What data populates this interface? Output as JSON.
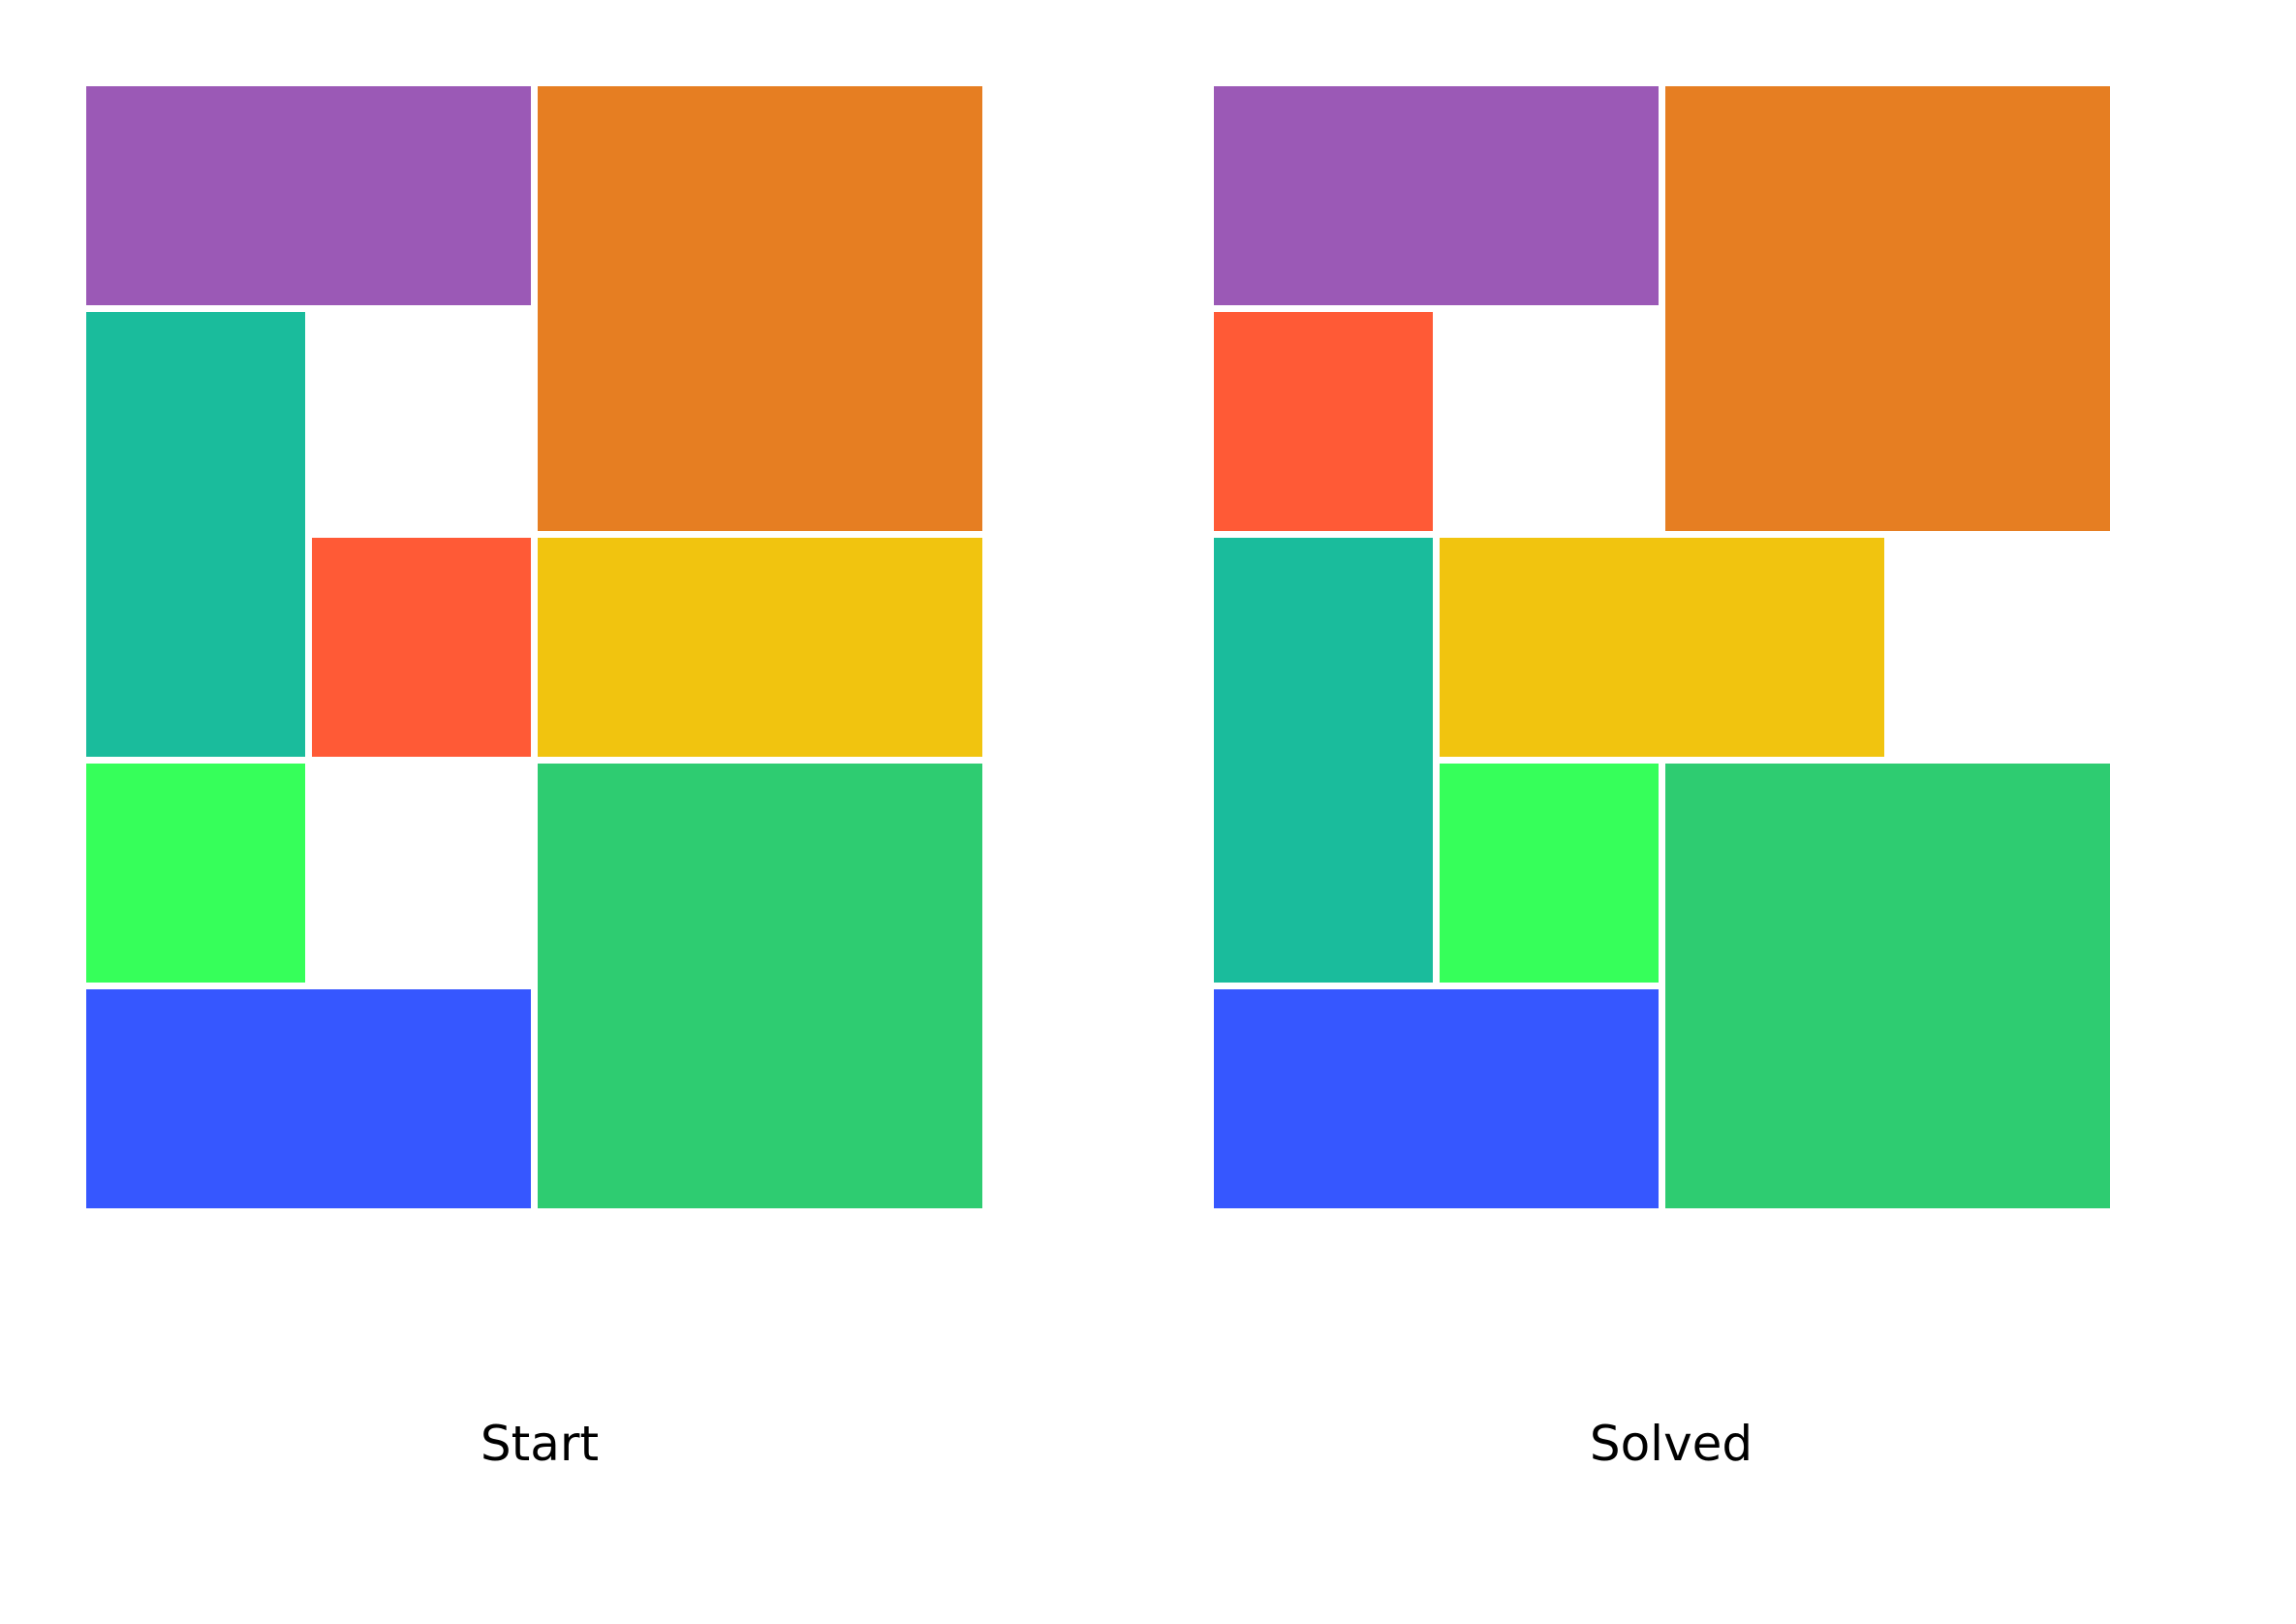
{
  "puzzle": {
    "grid": {
      "cols": 4,
      "rows": 5
    },
    "colors": {
      "purple": "#9b59b6",
      "orange": "#e67e22",
      "teal": "#1abc9c",
      "red": "#ff5a36",
      "yellow": "#f1c40f",
      "green": "#2ecc71",
      "lime": "#36ff5a",
      "blue": "#3657ff"
    },
    "boards": [
      {
        "id": "start",
        "caption": "Start",
        "pieces": [
          {
            "name": "purple-block",
            "color": "#9b59b6",
            "col": 0,
            "row": 0,
            "w": 2,
            "h": 1
          },
          {
            "name": "orange-block",
            "color": "#e67e22",
            "col": 2,
            "row": 0,
            "w": 2,
            "h": 2
          },
          {
            "name": "teal-block",
            "color": "#1abc9c",
            "col": 0,
            "row": 1,
            "w": 1,
            "h": 2
          },
          {
            "name": "red-block",
            "color": "#ff5a36",
            "col": 1,
            "row": 2,
            "w": 1,
            "h": 1
          },
          {
            "name": "yellow-block",
            "color": "#f1c40f",
            "col": 2,
            "row": 2,
            "w": 2,
            "h": 1
          },
          {
            "name": "lime-block",
            "color": "#36ff5a",
            "col": 0,
            "row": 3,
            "w": 1,
            "h": 1
          },
          {
            "name": "green-block",
            "color": "#2ecc71",
            "col": 2,
            "row": 3,
            "w": 2,
            "h": 2
          },
          {
            "name": "blue-block",
            "color": "#3657ff",
            "col": 0,
            "row": 4,
            "w": 2,
            "h": 1
          }
        ]
      },
      {
        "id": "solved",
        "caption": "Solved",
        "pieces": [
          {
            "name": "purple-block",
            "color": "#9b59b6",
            "col": 0,
            "row": 0,
            "w": 2,
            "h": 1
          },
          {
            "name": "orange-block",
            "color": "#e67e22",
            "col": 2,
            "row": 0,
            "w": 2,
            "h": 2
          },
          {
            "name": "red-block",
            "color": "#ff5a36",
            "col": 0,
            "row": 1,
            "w": 1,
            "h": 1
          },
          {
            "name": "teal-block",
            "color": "#1abc9c",
            "col": 0,
            "row": 2,
            "w": 1,
            "h": 2
          },
          {
            "name": "yellow-block",
            "color": "#f1c40f",
            "col": 1,
            "row": 2,
            "w": 2,
            "h": 1
          },
          {
            "name": "lime-block",
            "color": "#36ff5a",
            "col": 1,
            "row": 3,
            "w": 1,
            "h": 1
          },
          {
            "name": "green-block",
            "color": "#2ecc71",
            "col": 2,
            "row": 3,
            "w": 2,
            "h": 2
          },
          {
            "name": "blue-block",
            "color": "#3657ff",
            "col": 0,
            "row": 4,
            "w": 2,
            "h": 1
          }
        ]
      }
    ]
  }
}
